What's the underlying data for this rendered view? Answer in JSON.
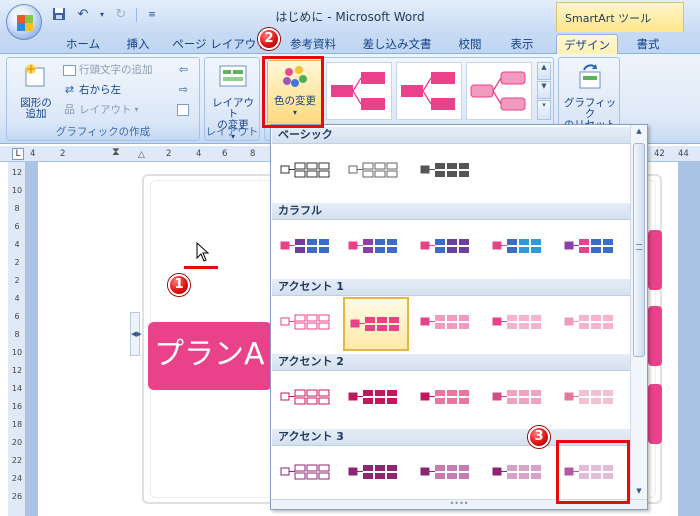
{
  "window": {
    "title": "はじめに - Microsoft Word",
    "context_tab_group": "SmartArt ツール"
  },
  "qat": {
    "save_icon": "save-icon",
    "undo_icon": "undo-icon",
    "redo_icon": "redo-icon",
    "customize_icon": "qat-dropdown-icon"
  },
  "tabs": [
    {
      "label": "ホーム"
    },
    {
      "label": "挿入"
    },
    {
      "label": "ページ レイアウト"
    },
    {
      "label": "参考資料"
    },
    {
      "label": "差し込み文書"
    },
    {
      "label": "校閲"
    },
    {
      "label": "表示"
    },
    {
      "label": "デザイン",
      "active": true
    },
    {
      "label": "書式"
    }
  ],
  "ribbon": {
    "create_graphic": {
      "label": "グラフィックの作成",
      "add_shape": "図形の\n追加",
      "add_bullet": "行頭文字の追加",
      "right_to_left": "右から左",
      "layout": "レイアウト"
    },
    "layouts": {
      "label": "レイアウト",
      "change_layout": "レイアウト\nの変更"
    },
    "smartart_styles": {
      "change_colors": "色の変更"
    },
    "reset": {
      "reset_graphic": "グラフィック\nのリセット"
    }
  },
  "ruler": {
    "top_ticks": [
      "4",
      "2",
      "2",
      "4",
      "6",
      "8"
    ],
    "top_ticks_right": [
      "42",
      "44"
    ],
    "left_ticks": [
      "12",
      "10",
      "8",
      "6",
      "4",
      "2",
      "2",
      "4",
      "6",
      "8",
      "10",
      "12",
      "14",
      "16",
      "18",
      "20",
      "22",
      "24",
      "26"
    ]
  },
  "document": {
    "plan_text": "プランA"
  },
  "color_gallery": {
    "categories": [
      {
        "name": "ベーシック",
        "options": 3
      },
      {
        "name": "カラフル",
        "options": 5
      },
      {
        "name": "アクセント 1",
        "options": 5,
        "selected": 1
      },
      {
        "name": "アクセント 2",
        "options": 5
      },
      {
        "name": "アクセント 3",
        "options": 5,
        "highlighted": 4
      }
    ]
  },
  "annotations": {
    "badge_1": "1",
    "badge_2": "2",
    "badge_3": "3"
  },
  "colors": {
    "accent_pink": "#e9418a",
    "annotation_red": "#e30b0b",
    "selection_gold": "#e8b44a"
  }
}
